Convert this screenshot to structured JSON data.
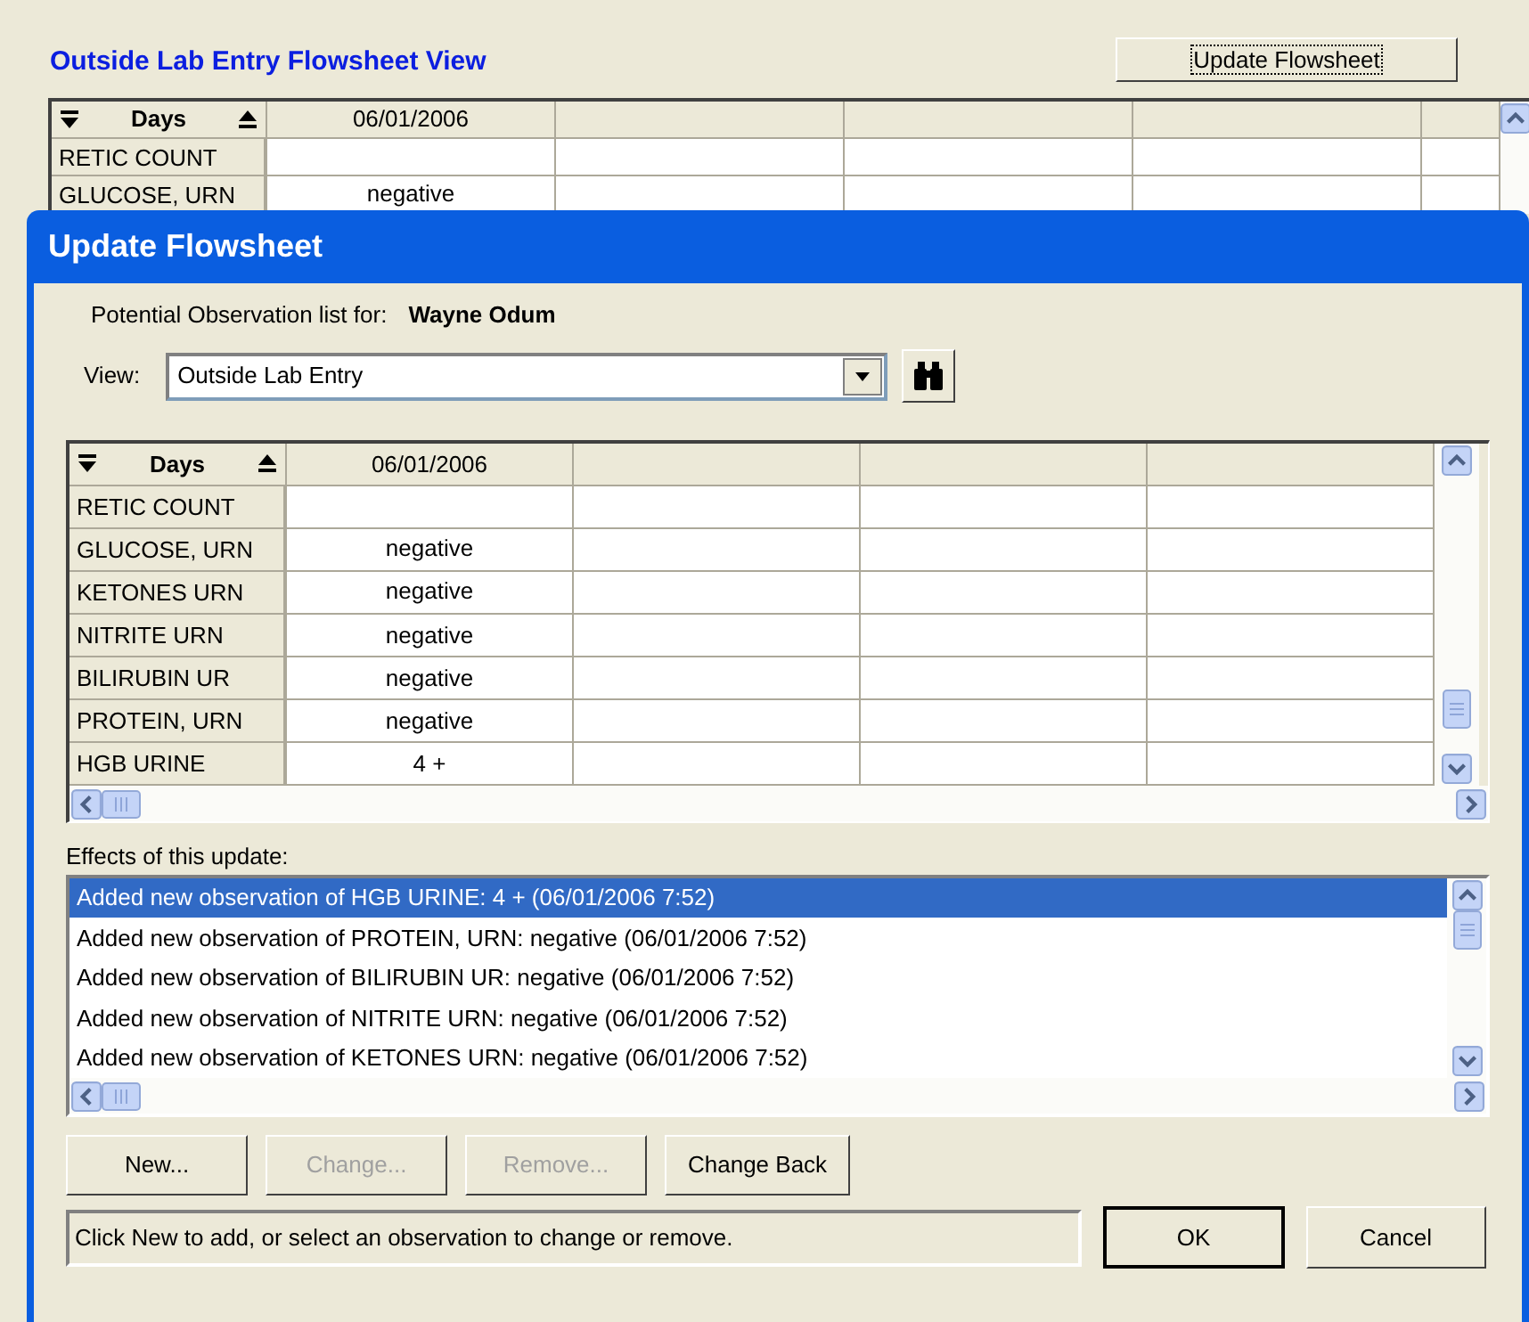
{
  "page_title": "Outside Lab Entry Flowsheet View",
  "update_button": "Update Flowsheet",
  "background_grid": {
    "header": "Days",
    "columns": [
      "06/01/2006"
    ],
    "rows": [
      {
        "name": "RETIC COUNT",
        "value": ""
      },
      {
        "name": "GLUCOSE, URN",
        "value": "negative"
      }
    ]
  },
  "dialog": {
    "title": "Update Flowsheet",
    "patient_label": "Potential Observation list for:",
    "patient_name": "Wayne Odum",
    "view_label": "View:",
    "view_value": "Outside Lab Entry",
    "grid": {
      "header": "Days",
      "columns": [
        "06/01/2006"
      ],
      "rows": [
        {
          "name": "RETIC COUNT",
          "value": ""
        },
        {
          "name": "GLUCOSE, URN",
          "value": "negative"
        },
        {
          "name": "KETONES URN",
          "value": "negative"
        },
        {
          "name": "NITRITE URN",
          "value": "negative"
        },
        {
          "name": "BILIRUBIN UR",
          "value": "negative"
        },
        {
          "name": "PROTEIN, URN",
          "value": "negative"
        },
        {
          "name": "HGB URINE",
          "value": "4 +"
        }
      ]
    },
    "effects_label": "Effects of this update:",
    "effects": [
      {
        "text": "Added new observation of HGB URINE: 4 + (06/01/2006 7:52)",
        "selected": true
      },
      {
        "text": "Added new observation of PROTEIN, URN: negative (06/01/2006 7:52)",
        "selected": false
      },
      {
        "text": "Added new observation of BILIRUBIN UR: negative (06/01/2006 7:52)",
        "selected": false
      },
      {
        "text": "Added new observation of NITRITE URN: negative (06/01/2006 7:52)",
        "selected": false
      },
      {
        "text": "Added new observation of KETONES URN: negative (06/01/2006 7:52)",
        "selected": false
      }
    ],
    "buttons": [
      {
        "label": "New...",
        "disabled": false
      },
      {
        "label": "Change...",
        "disabled": true
      },
      {
        "label": "Remove...",
        "disabled": true
      },
      {
        "label": "Change Back",
        "disabled": false
      }
    ],
    "status": "Click New to add, or select an observation to change or remove.",
    "ok": "OK",
    "cancel": "Cancel"
  }
}
